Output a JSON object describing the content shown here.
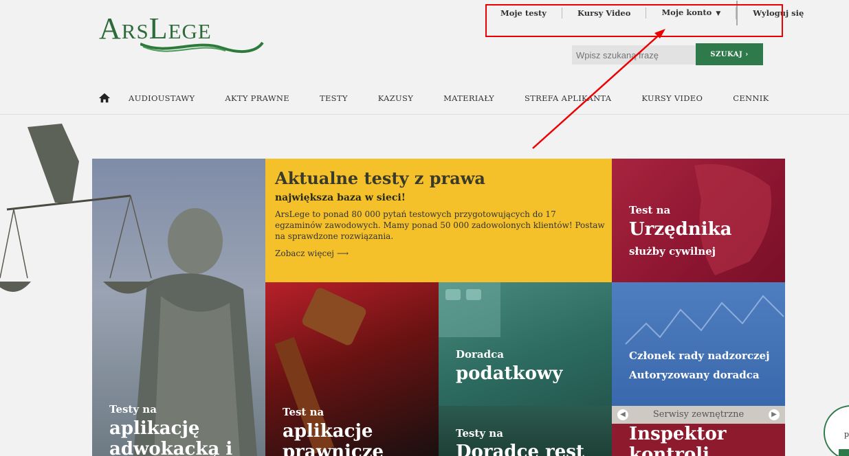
{
  "header": {
    "logo_text": "ArsLege",
    "topnav": [
      {
        "label": "Moje testy"
      },
      {
        "label": "Kursy Video"
      },
      {
        "label": "Moje konto"
      },
      {
        "label": "Wyloguj się"
      }
    ],
    "search": {
      "placeholder": "Wpisz szukaną frazę",
      "button_label": "SZUKAJ"
    }
  },
  "mainnav": {
    "items": [
      "AUDIOUSTAWY",
      "AKTY PRAWNE",
      "TESTY",
      "KAZUSY",
      "MATERIAŁY",
      "STREFA APLIKANTA",
      "KURSY VIDEO",
      "CENNIK"
    ]
  },
  "hero": {
    "title": "Aktualne testy z prawa",
    "subtitle": "największa baza w sieci!",
    "body": "ArsLege to ponad 80 000 pytań testowych przygotowujących do 17 egzaminów zawodowych. Mamy ponad 50 000 zadowolonych klientów! Postaw na sprawdzone rozwiązania.",
    "more": "Zobacz więcej"
  },
  "tiles": {
    "urzednik": {
      "small": "Test na",
      "large": "Urzędnika",
      "small2": "służby cywilnej"
    },
    "adwokacka": {
      "small": "Testy na",
      "large1": "aplikację",
      "large2": "adwokacką i"
    },
    "prawnicze": {
      "small": "Test na",
      "large1": "aplikacje",
      "large2": "prawnicze"
    },
    "podatkowy": {
      "small": "Doradca",
      "large": "podatkowy"
    },
    "rada": {
      "line1": "Członek rady nadzorczej",
      "line2": "Autoryzowany doradca"
    },
    "restruk": {
      "small": "Testy na",
      "large": "Doradcę rest"
    },
    "serwisy": {
      "label": "Serwisy zewnętrzne"
    },
    "inspektor": {
      "large1": "Inspektor",
      "large2": "kontroli"
    }
  },
  "widget": {
    "text": "pl"
  },
  "colors": {
    "accent_green": "#2f7a4a",
    "yellow": "#f5c12b",
    "highlight_red": "#e00000"
  }
}
